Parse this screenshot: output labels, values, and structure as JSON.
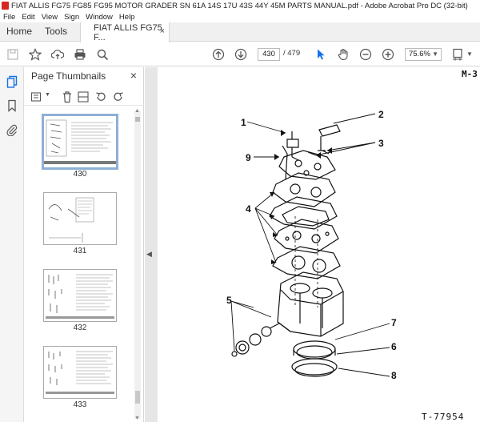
{
  "window": {
    "title": "FIAT ALLIS FG75 FG85 FG95 MOTOR GRADER SN 61A 14S 17U 43S 44Y 45M PARTS MANUAL.pdf - Adobe Acrobat Pro DC (32-bit)"
  },
  "menu": [
    "File",
    "Edit",
    "View",
    "Sign",
    "Window",
    "Help"
  ],
  "tabs": {
    "home": "Home",
    "tools": "Tools",
    "document": "FIAT ALLIS FG75 F...",
    "close": "×"
  },
  "toolbar": {
    "icons": [
      "save-icon",
      "star-icon",
      "cloud-upload-icon",
      "print-icon",
      "search-icon",
      "prev-page-icon",
      "next-page-icon",
      "select-cursor-icon",
      "hand-icon",
      "zoom-out-icon",
      "zoom-in-icon",
      "fit-page-icon"
    ],
    "current_page": "430",
    "total_pages": "/ 479",
    "zoom": "75.6%"
  },
  "sidebar": {
    "title": "Page Thumbnails",
    "close": "×",
    "thumbnails": [
      {
        "label": "430",
        "selected": true
      },
      {
        "label": "431",
        "selected": false
      },
      {
        "label": "432",
        "selected": false
      },
      {
        "label": "433",
        "selected": false
      }
    ]
  },
  "document": {
    "page_mark": "M-3",
    "figure_ref": "T-77954",
    "callouts": [
      "1",
      "2",
      "3",
      "9",
      "4",
      "5",
      "7",
      "6",
      "8"
    ]
  },
  "colors": {
    "accent": "#1473e6",
    "selected_thumb_border": "#8fb0d6",
    "tab_bg": "#f0f0f0"
  }
}
